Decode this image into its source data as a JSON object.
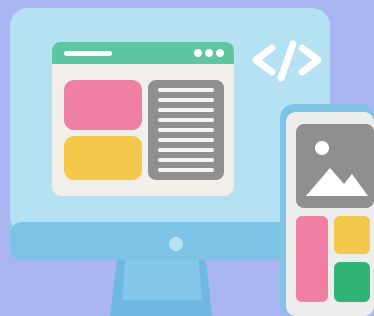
{
  "illustration": {
    "colors": {
      "background": "#a9b6f2",
      "monitor_body": "#a9dbee",
      "monitor_bezel": "#7fc6e6",
      "window_frame": "#f1ede8",
      "window_titlebar": "#5ec6a0",
      "block_pink": "#ef7fa3",
      "block_yellow": "#f3c84b",
      "text_panel": "#8f8f8f",
      "phone_frame": "#a9dbee",
      "phone_screen": "#ededed",
      "phone_green": "#2fb377"
    },
    "icons": [
      "code-icon",
      "image-icon",
      "window-dots-icon"
    ]
  }
}
